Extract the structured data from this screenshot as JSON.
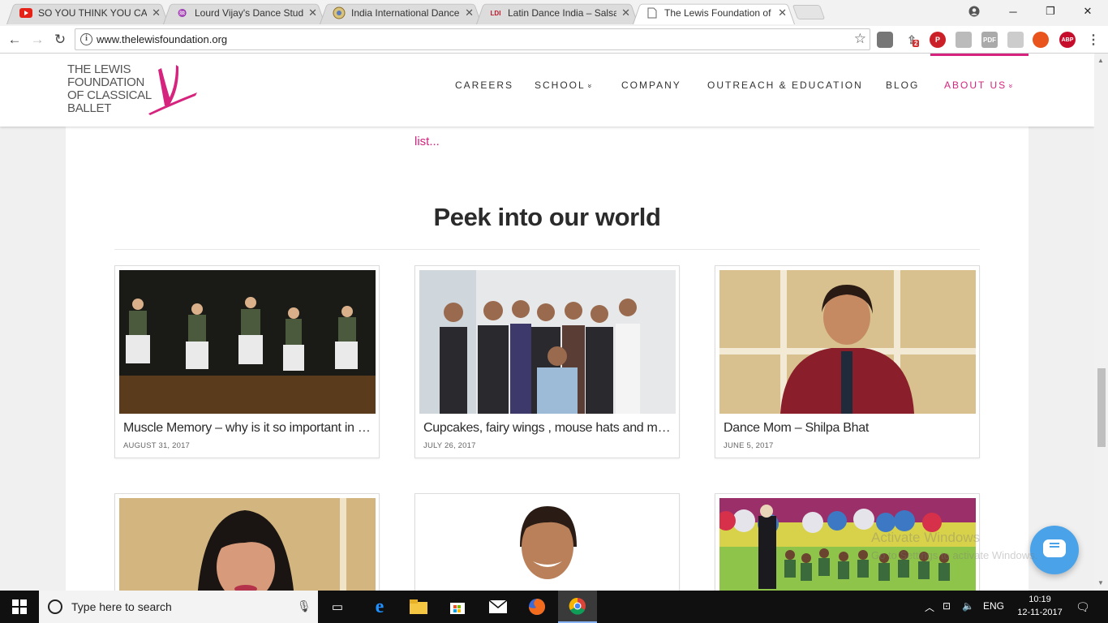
{
  "browser": {
    "tabs": [
      {
        "title": "SO YOU THINK YOU CAN",
        "favicon": "youtube-icon",
        "active": false
      },
      {
        "title": "Lourd Vijay's Dance Stud",
        "favicon": "dance-studio-icon",
        "active": false
      },
      {
        "title": "India International Dance",
        "favicon": "globe-seal-icon",
        "active": false
      },
      {
        "title": "Latin Dance India – Salsa",
        "favicon": "ldi-icon",
        "active": false
      },
      {
        "title": "The Lewis Foundation of",
        "favicon": "page-icon",
        "active": true
      }
    ],
    "url": "www.thelewisfoundation.org",
    "extension_badge": "2",
    "extensions": [
      "briefcase-icon",
      "share-icon",
      "pinterest-icon",
      "acrobat-icon",
      "pdf-icon",
      "qr-icon",
      "flame-icon",
      "adblock-icon",
      "menu-icon"
    ],
    "extension_labels": {
      "pdf": "PDF",
      "abp": "ABP"
    }
  },
  "site": {
    "logo_lines": [
      "THE LEWIS",
      "FOUNDATION",
      "OF CLASSICAL",
      "BALLET"
    ],
    "nav": [
      {
        "label": "CAREERS",
        "dropdown": false,
        "active": false
      },
      {
        "label": "SCHOOL",
        "dropdown": true,
        "active": false
      },
      {
        "label": "COMPANY",
        "dropdown": false,
        "active": false
      },
      {
        "label": "OUTREACH & EDUCATION",
        "dropdown": false,
        "active": false
      },
      {
        "label": "BLOG",
        "dropdown": false,
        "active": false
      },
      {
        "label": "ABOUT US",
        "dropdown": true,
        "active": true
      }
    ],
    "accent_color": "#d6247e",
    "dropdown_glyph": "»"
  },
  "main": {
    "readmore": "list...",
    "section_title": "Peek into our world",
    "posts": [
      {
        "title": "Muscle Memory – why is it so important in …",
        "date": "AUGUST 31, 2017",
        "image": "ballet-stage-photo"
      },
      {
        "title": "Cupcakes, fairy wings , mouse hats and mo…",
        "date": "JULY 26, 2017",
        "image": "group-photo"
      },
      {
        "title": "Dance Mom – Shilpa Bhat",
        "date": "JUNE 5, 2017",
        "image": "portrait-woman-photo"
      },
      {
        "title": "",
        "date": "",
        "image": "portrait-woman-2-photo"
      },
      {
        "title": "",
        "date": "",
        "image": "portrait-girl-photo"
      },
      {
        "title": "",
        "date": "",
        "image": "classroom-photo"
      }
    ]
  },
  "watermark": {
    "line1": "Activate Windows",
    "line2": "Go to Settings to activate Windows."
  },
  "taskbar": {
    "search_placeholder": "Type here to search",
    "language": "ENG",
    "time": "10:19",
    "date": "12-11-2017"
  }
}
